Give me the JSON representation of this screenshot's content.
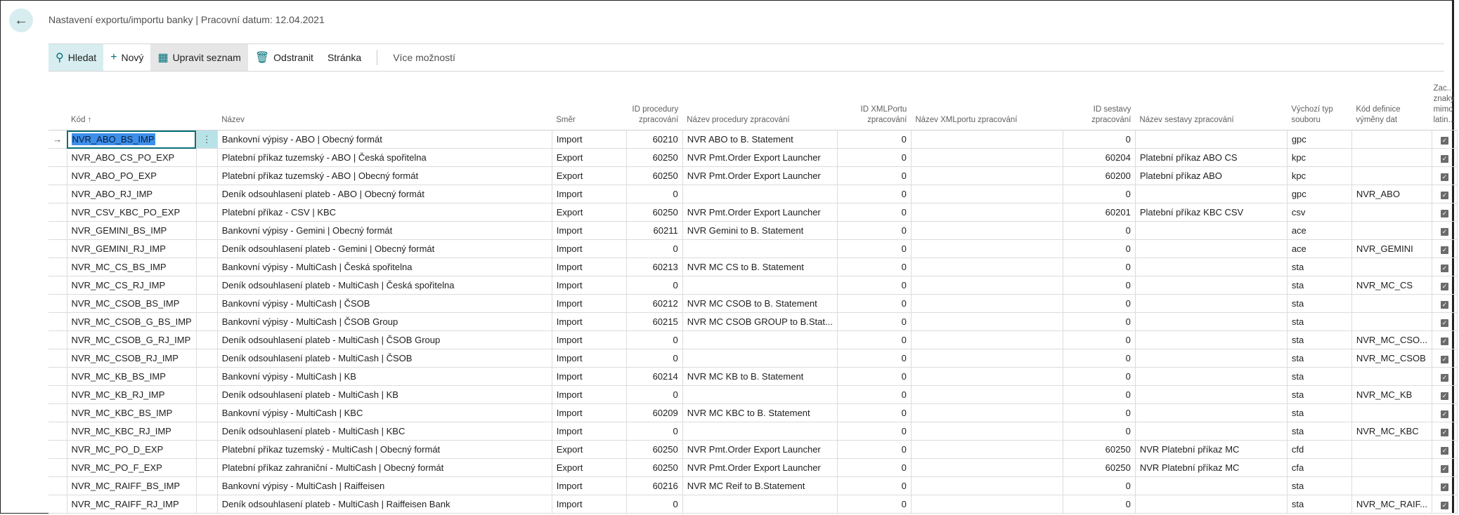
{
  "header": {
    "title": "Nastavení exportu/importu banky | Pracovní datum: 12.04.2021",
    "back_icon": "arrow-left-icon"
  },
  "toolbar": {
    "search": "Hledat",
    "new": "Nový",
    "edit_list": "Upravit seznam",
    "delete": "Odstranit",
    "page": "Stránka",
    "more": "Více možností"
  },
  "columns": {
    "code": "Kód ↑",
    "name": "Název",
    "direction": "Směr",
    "proc_id": "ID procedury zpracování",
    "proc_name": "Název procedury zpracování",
    "xml_id": "ID XMLPortu zpracování",
    "xml_name": "Název XMLportu zpracování",
    "report_id": "ID sestavy zpracování",
    "report_name": "Název sestavy zpracování",
    "file_type": "Výchozí typ souboru",
    "exch_def": "Kód definice výměny dat",
    "nonlatin": "Zac... znaky mimo latin..."
  },
  "rows": [
    [
      "NVR_ABO_BS_IMP",
      "Bankovní výpisy - ABO | Obecný formát",
      "Import",
      "60210",
      "NVR ABO to B. Statement",
      "0",
      "",
      "0",
      "",
      "gpc",
      "",
      true
    ],
    [
      "NVR_ABO_CS_PO_EXP",
      "Platební příkaz tuzemský - ABO | Česká spořitelna",
      "Export",
      "60250",
      "NVR Pmt.Order Export Launcher",
      "0",
      "",
      "60204",
      "Platební příkaz ABO CS",
      "kpc",
      "",
      true
    ],
    [
      "NVR_ABO_PO_EXP",
      "Platební příkaz tuzemský - ABO |  Obecný formát",
      "Export",
      "60250",
      "NVR Pmt.Order Export Launcher",
      "0",
      "",
      "60200",
      "Platební příkaz ABO",
      "kpc",
      "",
      true
    ],
    [
      "NVR_ABO_RJ_IMP",
      "Deník odsouhlasení plateb - ABO |  Obecný formát",
      "Import",
      "0",
      "",
      "0",
      "",
      "0",
      "",
      "gpc",
      "NVR_ABO",
      true
    ],
    [
      "NVR_CSV_KBC_PO_EXP",
      "Platební příkaz - CSV | KBC",
      "Export",
      "60250",
      "NVR Pmt.Order Export Launcher",
      "0",
      "",
      "60201",
      "Platební příkaz KBC CSV",
      "csv",
      "",
      true
    ],
    [
      "NVR_GEMINI_BS_IMP",
      "Bankovní výpisy - Gemini |  Obecný formát",
      "Import",
      "60211",
      "NVR Gemini to B. Statement",
      "0",
      "",
      "0",
      "",
      "ace",
      "",
      true
    ],
    [
      "NVR_GEMINI_RJ_IMP",
      "Deník odsouhlasení plateb - Gemini | Obecný formát",
      "Import",
      "0",
      "",
      "0",
      "",
      "0",
      "",
      "ace",
      "NVR_GEMINI",
      true
    ],
    [
      "NVR_MC_CS_BS_IMP",
      "Bankovní výpisy - MultiCash | Česká spořitelna",
      "Import",
      "60213",
      "NVR MC CS to B. Statement",
      "0",
      "",
      "0",
      "",
      "sta",
      "",
      true
    ],
    [
      "NVR_MC_CS_RJ_IMP",
      "Deník odsouhlasení plateb - MultiCash | Česká spořitelna",
      "Import",
      "0",
      "",
      "0",
      "",
      "0",
      "",
      "sta",
      "NVR_MC_CS",
      true
    ],
    [
      "NVR_MC_CSOB_BS_IMP",
      "Bankovní výpisy - MultiCash | ČSOB",
      "Import",
      "60212",
      "NVR MC CSOB to B. Statement",
      "0",
      "",
      "0",
      "",
      "sta",
      "",
      true
    ],
    [
      "NVR_MC_CSOB_G_BS_IMP",
      "Bankovní výpisy - MultiCash | ČSOB Group",
      "Import",
      "60215",
      "NVR MC CSOB GROUP to B.Stat...",
      "0",
      "",
      "0",
      "",
      "sta",
      "",
      true
    ],
    [
      "NVR_MC_CSOB_G_RJ_IMP",
      "Deník odsouhlasení plateb - MultiCash | ČSOB Group",
      "Import",
      "0",
      "",
      "0",
      "",
      "0",
      "",
      "sta",
      "NVR_MC_CSO...",
      true
    ],
    [
      "NVR_MC_CSOB_RJ_IMP",
      "Deník odsouhlasení plateb - MultiCash | ČSOB",
      "Import",
      "0",
      "",
      "0",
      "",
      "0",
      "",
      "sta",
      "NVR_MC_CSOB",
      true
    ],
    [
      "NVR_MC_KB_BS_IMP",
      "Bankovní výpisy - MultiCash | KB",
      "Import",
      "60214",
      "NVR MC KB to B. Statement",
      "0",
      "",
      "0",
      "",
      "sta",
      "",
      true
    ],
    [
      "NVR_MC_KB_RJ_IMP",
      "Deník odsouhlasení plateb - MultiCash | KB",
      "Import",
      "0",
      "",
      "0",
      "",
      "0",
      "",
      "sta",
      "NVR_MC_KB",
      true
    ],
    [
      "NVR_MC_KBC_BS_IMP",
      "Bankovní výpisy - MultiCash | KBC",
      "Import",
      "60209",
      "NVR MC KBC to B. Statement",
      "0",
      "",
      "0",
      "",
      "sta",
      "",
      true
    ],
    [
      "NVR_MC_KBC_RJ_IMP",
      "Deník odsouhlasení plateb - MultiCash | KBC",
      "Import",
      "0",
      "",
      "0",
      "",
      "0",
      "",
      "sta",
      "NVR_MC_KBC",
      true
    ],
    [
      "NVR_MC_PO_D_EXP",
      "Platební příkaz tuzemský - MultiCash | Obecný formát",
      "Export",
      "60250",
      "NVR Pmt.Order Export Launcher",
      "0",
      "",
      "60250",
      "NVR Platební příkaz MC",
      "cfd",
      "",
      true
    ],
    [
      "NVR_MC_PO_F_EXP",
      "Platební příkaz zahraniční - MultiCash | Obecný formát",
      "Export",
      "60250",
      "NVR Pmt.Order Export Launcher",
      "0",
      "",
      "60250",
      "NVR Platební příkaz MC",
      "cfa",
      "",
      true
    ],
    [
      "NVR_MC_RAIFF_BS_IMP",
      "Bankovní výpisy - MultiCash | Raiffeisen",
      "Import",
      "60216",
      "NVR MC Reif to B.Statement",
      "0",
      "",
      "0",
      "",
      "sta",
      "",
      true
    ],
    [
      "NVR_MC_RAIFF_RJ_IMP",
      "Deník odsouhlasení plateb - MultiCash | Raiffeisen Bank",
      "Import",
      "0",
      "",
      "0",
      "",
      "0",
      "",
      "sta",
      "NVR_MC_RAIF...",
      true
    ]
  ],
  "selected_row": 0,
  "colors": {
    "accent": "#00707a",
    "selection": "#3d8fe9",
    "search_bg": "#d7edf0"
  }
}
